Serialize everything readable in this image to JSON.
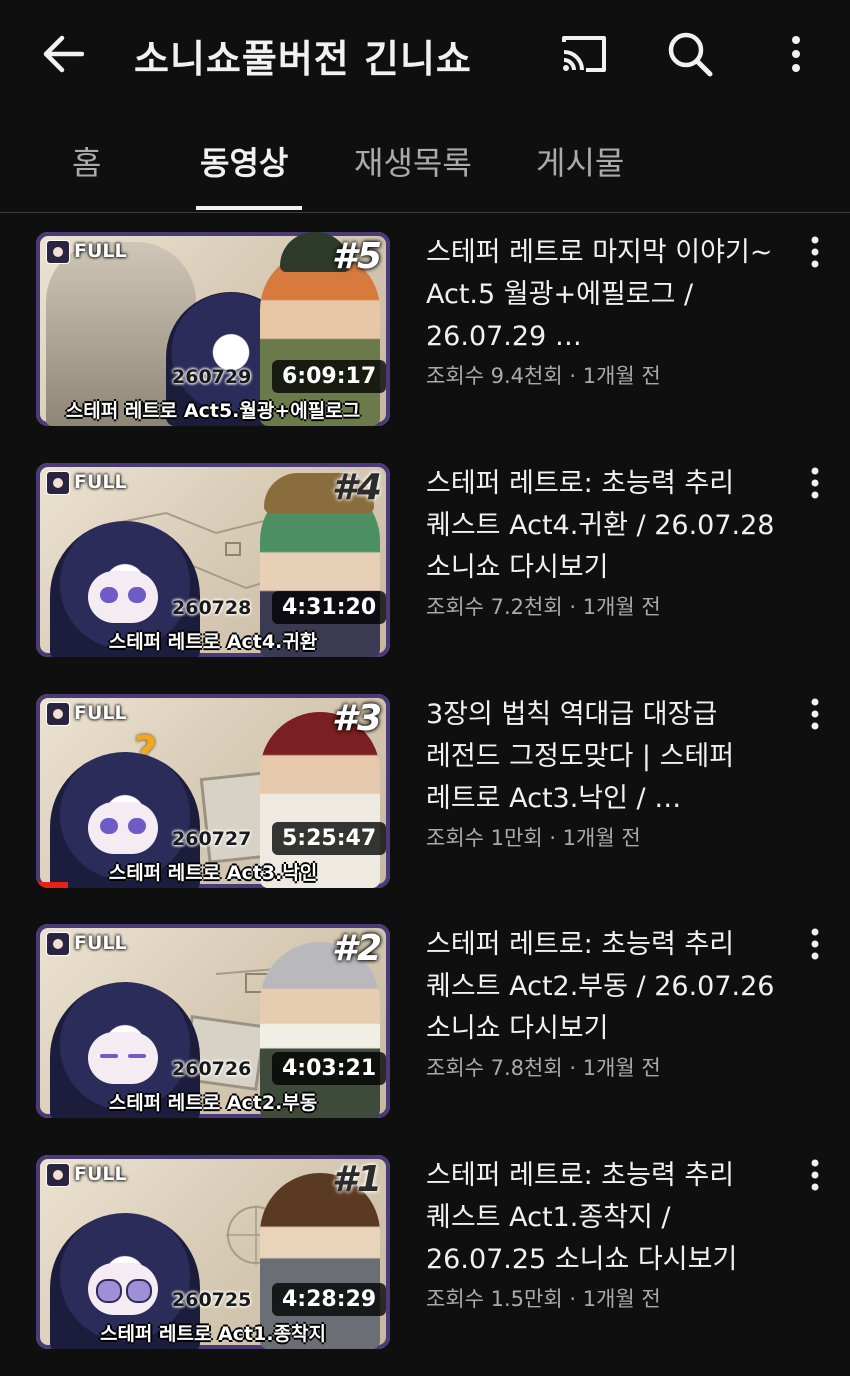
{
  "header": {
    "title": "소니쇼풀버전 긴니쇼",
    "back_icon": "arrow-left-icon",
    "cast_icon": "cast-icon",
    "search_icon": "search-icon",
    "more_icon": "more-vertical-icon"
  },
  "tabs": [
    {
      "label": "홈",
      "active": false
    },
    {
      "label": "동영상",
      "active": true
    },
    {
      "label": "재생목록",
      "active": false
    },
    {
      "label": "게시물",
      "active": false
    }
  ],
  "videos": [
    {
      "title": "스테퍼 레트로 마지막 이야기~ Act.5 월광+에필로그 / 26.07.29 …",
      "views": "조회수 9.4천회",
      "age": "1개월 전",
      "duration": "6:09:17",
      "badge": "FULL",
      "episode": "#5",
      "date_code": "260729",
      "caption": "스테퍼 레트로 Act5.월광+에필로그",
      "watched_fraction": 0
    },
    {
      "title": "스테퍼 레트로: 초능력 추리 퀘스트 Act4.귀환 / 26.07.28 소니쇼 다시보기",
      "views": "조회수 7.2천회",
      "age": "1개월 전",
      "duration": "4:31:20",
      "badge": "FULL",
      "episode": "#4",
      "date_code": "260728",
      "caption": "스테퍼 레트로 Act4.귀환",
      "watched_fraction": 0
    },
    {
      "title": "3장의 법칙 역대급 대장급 레전드 그정도맞다 | 스테퍼 레트로 Act3.낙인 / …",
      "views": "조회수 1만회",
      "age": "1개월 전",
      "duration": "5:25:47",
      "badge": "FULL",
      "episode": "#3",
      "date_code": "260727",
      "caption": "스테퍼 레트로 Act3.낙인",
      "watched_fraction": 0.09
    },
    {
      "title": "스테퍼 레트로: 초능력 추리 퀘스트 Act2.부동 / 26.07.26 소니쇼 다시보기",
      "views": "조회수 7.8천회",
      "age": "1개월 전",
      "duration": "4:03:21",
      "badge": "FULL",
      "episode": "#2",
      "date_code": "260726",
      "caption": "스테퍼 레트로 Act2.부동",
      "watched_fraction": 0
    },
    {
      "title": "스테퍼 레트로: 초능력 추리 퀘스트 Act1.종착지 / 26.07.25 소니쇼 다시보기",
      "views": "조회수 1.5만회",
      "age": "1개월 전",
      "duration": "4:28:29",
      "badge": "FULL",
      "episode": "#1",
      "date_code": "260725",
      "caption": "스테퍼 레트로 Act1.종착지",
      "watched_fraction": 0
    }
  ],
  "meta_separator": " · ",
  "colors": {
    "background": "#0f0f0f",
    "text_primary": "#f1f1f1",
    "text_secondary": "#aaaaaa",
    "progress_red": "#e62117"
  }
}
